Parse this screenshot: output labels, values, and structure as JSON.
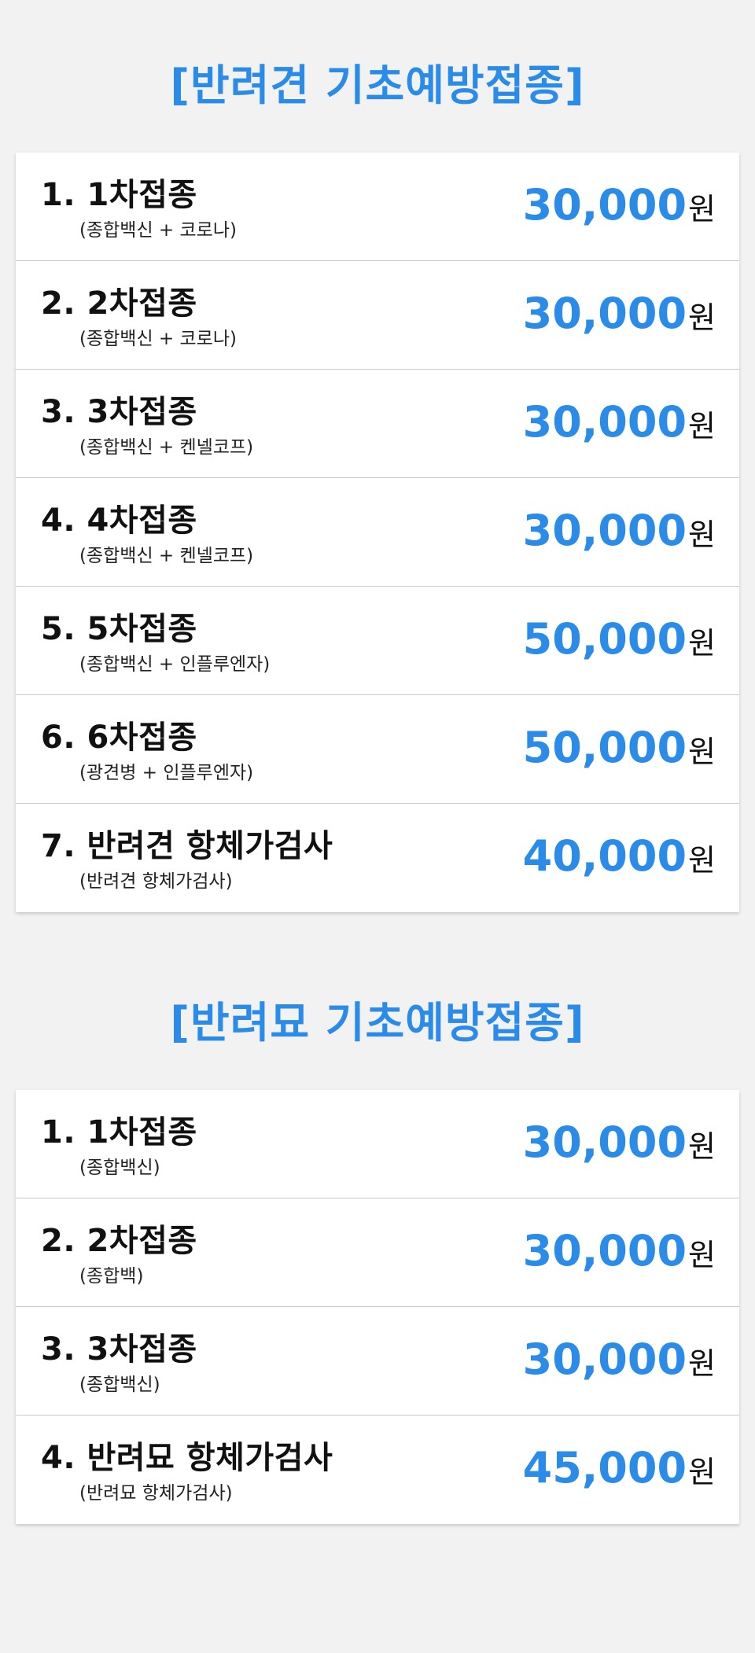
{
  "dog": {
    "title": "[반려견 기초예방접종]",
    "items": [
      {
        "title": "1. 1차접종",
        "sub": "(종합백신 + 코로나)",
        "price": "30,000",
        "unit": "원"
      },
      {
        "title": "2. 2차접종",
        "sub": "(종합백신 + 코로나)",
        "price": "30,000",
        "unit": "원"
      },
      {
        "title": "3. 3차접종",
        "sub": "(종합백신 + 켄넬코프)",
        "price": "30,000",
        "unit": "원"
      },
      {
        "title": "4. 4차접종",
        "sub": "(종합백신 + 켄넬코프)",
        "price": "30,000",
        "unit": "원"
      },
      {
        "title": "5. 5차접종",
        "sub": "(종합백신 + 인플루엔자)",
        "price": "50,000",
        "unit": "원"
      },
      {
        "title": "6. 6차접종",
        "sub": "(광견병 + 인플루엔자)",
        "price": "50,000",
        "unit": "원"
      },
      {
        "title": "7. 반려견 항체가검사",
        "sub": "(반려견 항체가검사)",
        "price": "40,000",
        "unit": "원"
      }
    ]
  },
  "cat": {
    "title": "[반려묘 기초예방접종]",
    "items": [
      {
        "title": "1. 1차접종",
        "sub": "(종합백신)",
        "price": "30,000",
        "unit": "원"
      },
      {
        "title": "2. 2차접종",
        "sub": "(종합백)",
        "price": "30,000",
        "unit": "원"
      },
      {
        "title": "3. 3차접종",
        "sub": "(종합백신)",
        "price": "30,000",
        "unit": "원"
      },
      {
        "title": "4. 반려묘 항체가검사",
        "sub": "(반려묘 항체가검사)",
        "price": "45,000",
        "unit": "원"
      }
    ]
  },
  "colors": {
    "accent": "#2a8be8",
    "background": "#f2f2f2",
    "card": "#ffffff",
    "divider": "#c9c9c9"
  }
}
